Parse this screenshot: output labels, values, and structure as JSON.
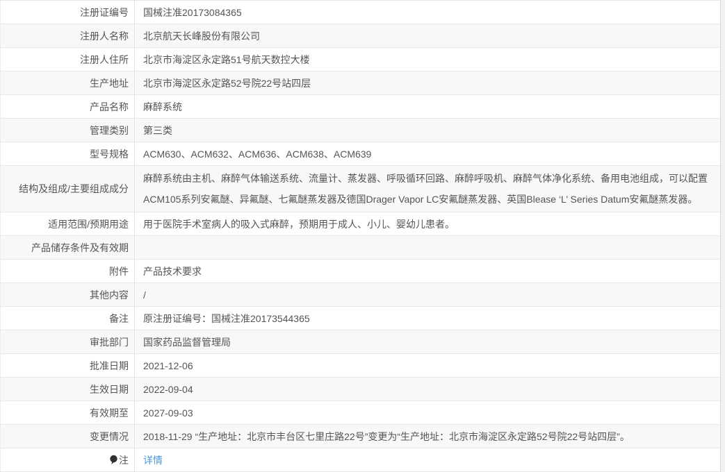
{
  "page": {
    "type": "medical-device-registration-detail",
    "colors": {
      "link": "#4e97d8",
      "row_stripe": "#f8f8f7",
      "border": "#e8e8e8"
    }
  },
  "table": {
    "rows": [
      {
        "label": "注册证编号",
        "value": "国械注准20173084365"
      },
      {
        "label": "注册人名称",
        "value": "北京航天长峰股份有限公司"
      },
      {
        "label": "注册人住所",
        "value": "北京市海淀区永定路51号航天数控大楼"
      },
      {
        "label": "生产地址",
        "value": "北京市海淀区永定路52号院22号站四层"
      },
      {
        "label": "产品名称",
        "value": "麻醉系统"
      },
      {
        "label": "管理类别",
        "value": "第三类"
      },
      {
        "label": "型号规格",
        "value": "ACM630、ACM632、ACM636、ACM638、ACM639"
      },
      {
        "label": "结构及组成/主要组成成分",
        "value": "麻醉系统由主机、麻醉气体输送系统、流量计、蒸发器、呼吸循环回路、麻醉呼吸机、麻醉气体净化系统、备用电池组成，可以配置ACM105系列安氟醚、异氟醚、七氟醚蒸发器及德国Drager Vapor LC安氟醚蒸发器、英国Blease ‘L’ Series Datum安氟醚蒸发器。"
      },
      {
        "label": "适用范围/预期用途",
        "value": "用于医院手术室病人的吸入式麻醉，预期用于成人、小儿、婴幼儿患者。"
      },
      {
        "label": "产品储存条件及有效期",
        "value": ""
      },
      {
        "label": "附件",
        "value": "产品技术要求"
      },
      {
        "label": "其他内容",
        "value": "/"
      },
      {
        "label": "备注",
        "value": "原注册证编号：国械注准20173544365"
      },
      {
        "label": "审批部门",
        "value": "国家药品监督管理局"
      },
      {
        "label": "批准日期",
        "value": "2021-12-06"
      },
      {
        "label": "生效日期",
        "value": "2022-09-04"
      },
      {
        "label": "有效期至",
        "value": "2027-09-03"
      },
      {
        "label": "变更情况",
        "value": "2018-11-29 “生产地址：北京市丰台区七里庄路22号”变更为“生产地址：北京市海淀区永定路52号院22号站四层”。"
      }
    ],
    "note_row": {
      "icon": "note-icon",
      "label": "注",
      "link_label": "详情"
    }
  }
}
